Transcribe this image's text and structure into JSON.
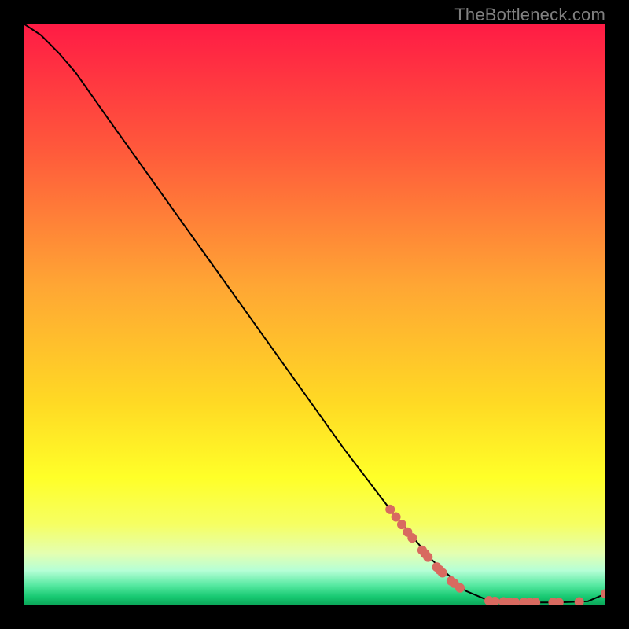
{
  "watermark": "TheBottleneck.com",
  "chart_data": {
    "type": "line",
    "title": "",
    "xlabel": "",
    "ylabel": "",
    "xlim": [
      0,
      100
    ],
    "ylim": [
      0,
      100
    ],
    "gradient_stops": [
      {
        "pct": 0,
        "color": "#ff1b45"
      },
      {
        "pct": 22,
        "color": "#ff5a3b"
      },
      {
        "pct": 45,
        "color": "#ffa634"
      },
      {
        "pct": 65,
        "color": "#ffd924"
      },
      {
        "pct": 78,
        "color": "#ffff28"
      },
      {
        "pct": 86,
        "color": "#f6ff62"
      },
      {
        "pct": 91,
        "color": "#e4ffb0"
      },
      {
        "pct": 94,
        "color": "#b6ffd6"
      },
      {
        "pct": 96.5,
        "color": "#58e9a2"
      },
      {
        "pct": 98.5,
        "color": "#18c972"
      },
      {
        "pct": 100,
        "color": "#0aa557"
      }
    ],
    "curve": [
      {
        "x": 0,
        "y": 100
      },
      {
        "x": 3,
        "y": 98
      },
      {
        "x": 6,
        "y": 95
      },
      {
        "x": 9,
        "y": 91.5
      },
      {
        "x": 15,
        "y": 83
      },
      {
        "x": 25,
        "y": 69
      },
      {
        "x": 35,
        "y": 55
      },
      {
        "x": 45,
        "y": 41
      },
      {
        "x": 55,
        "y": 27
      },
      {
        "x": 63,
        "y": 16.5
      },
      {
        "x": 70,
        "y": 8
      },
      {
        "x": 76,
        "y": 2.5
      },
      {
        "x": 80,
        "y": 0.8
      },
      {
        "x": 86,
        "y": 0.5
      },
      {
        "x": 92,
        "y": 0.5
      },
      {
        "x": 97,
        "y": 0.7
      },
      {
        "x": 100,
        "y": 2.0
      }
    ],
    "markers": [
      {
        "x": 63,
        "y": 16.5
      },
      {
        "x": 64,
        "y": 15.2
      },
      {
        "x": 65,
        "y": 13.9
      },
      {
        "x": 66,
        "y": 12.6
      },
      {
        "x": 66.8,
        "y": 11.6
      },
      {
        "x": 68.5,
        "y": 9.5
      },
      {
        "x": 69,
        "y": 8.9
      },
      {
        "x": 69.5,
        "y": 8.3
      },
      {
        "x": 71,
        "y": 6.6
      },
      {
        "x": 71.5,
        "y": 6.1
      },
      {
        "x": 72,
        "y": 5.6
      },
      {
        "x": 73.5,
        "y": 4.2
      },
      {
        "x": 74,
        "y": 3.8
      },
      {
        "x": 75,
        "y": 3.0
      },
      {
        "x": 80,
        "y": 0.8
      },
      {
        "x": 81,
        "y": 0.7
      },
      {
        "x": 82.5,
        "y": 0.6
      },
      {
        "x": 83.5,
        "y": 0.55
      },
      {
        "x": 84.5,
        "y": 0.5
      },
      {
        "x": 86,
        "y": 0.5
      },
      {
        "x": 87,
        "y": 0.5
      },
      {
        "x": 88,
        "y": 0.5
      },
      {
        "x": 91,
        "y": 0.5
      },
      {
        "x": 92,
        "y": 0.5
      },
      {
        "x": 95.5,
        "y": 0.6
      },
      {
        "x": 100,
        "y": 2.0
      }
    ],
    "marker_color": "#d86a60",
    "curve_color": "#000000"
  }
}
